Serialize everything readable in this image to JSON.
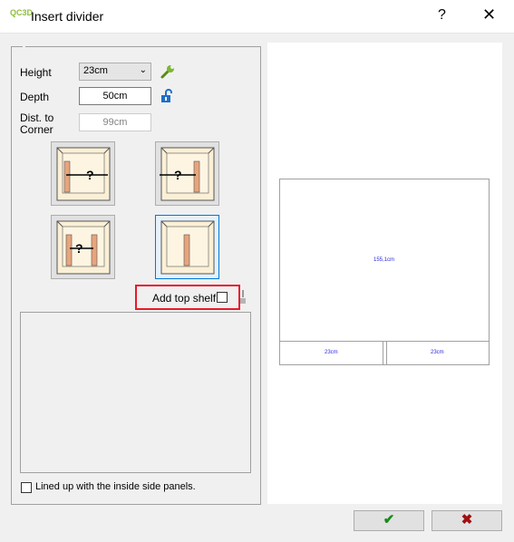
{
  "window": {
    "title": "Insert divider",
    "logo_text": "QC3D",
    "help_label": "?",
    "close_label": "✕"
  },
  "form": {
    "height_label": "Height",
    "height_value": "23cm",
    "depth_label": "Depth",
    "depth_value": "50cm",
    "dist_label_1": "Dist. to",
    "dist_label_2": "Corner",
    "dist_value": "99cm"
  },
  "add_top_shelf": {
    "label": "Add top shelf",
    "checked": false
  },
  "lined_up": {
    "label": "Lined up with the inside side panels.",
    "checked": false
  },
  "preview": {
    "top_dimension": "155,1cm",
    "left_dimension": "23cm",
    "right_dimension": "23cm"
  },
  "icons": [
    "wrench-icon",
    "unlock-icon",
    "brush-icon",
    "check-icon",
    "cross-icon"
  ],
  "colors": {
    "accent": "#0078d7",
    "highlight": "#e8192c",
    "dim_text": "#2b2bd6",
    "ok": "#1a8a1a",
    "cancel": "#a01010"
  }
}
